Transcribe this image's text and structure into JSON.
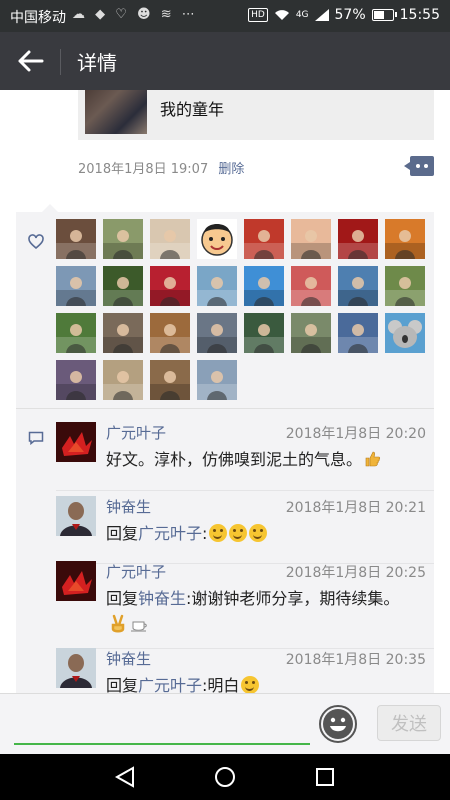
{
  "status_bar": {
    "carrier": "中国移动",
    "notification_icons": "☁ ◆ ♡ ☻ ≋ ⋯",
    "hd": "HD",
    "network": "4G",
    "battery": "57%",
    "battery_level": 0.57,
    "time": "15:55"
  },
  "title_bar": {
    "title": "详情"
  },
  "post": {
    "shared_title": "我的童年",
    "date": "2018年1月8日 19:07",
    "delete_label": "删除"
  },
  "likes": {
    "avatar_colors": [
      [
        "#6b4e3d",
        "#8a9a6a",
        "#d9c7b0",
        "#f2c98a",
        "#c0392b",
        "#e8b99a",
        "#a11818",
        "#d87a2a"
      ],
      [
        "#7d98b5",
        "#3c5a2a",
        "#b82030",
        "#7aa6c7",
        "#3f8fd6",
        "#cf5a5a",
        "#4e7fb0",
        "#6e8a4a"
      ],
      [
        "#4f7a3a",
        "#7a6a5a",
        "#9c6a3c",
        "#6a7686",
        "#3a5a3e",
        "#7a8a6a",
        "#4a6a9a",
        "#5aa0d0"
      ],
      [
        "#6a5a7a",
        "#b4a080",
        "#8a6a4a",
        "#8aa0b8"
      ]
    ],
    "avatar_icon_names": [
      "person-avatar-icon",
      "cartoon-face-avatar-icon",
      "koala-avatar-icon"
    ]
  },
  "comments": [
    {
      "name": "广元叶子",
      "time": "2018年1月8日 20:20",
      "text": "好文。淳朴，仿佛嗅到泥土的气息。",
      "emojis": [
        "thumbs-up-icon"
      ]
    },
    {
      "name": "钟奋生",
      "time": "2018年1月8日 20:21",
      "reply_prefix": "回复",
      "reply_to": "广元叶子",
      "text": ":",
      "emojis": [
        "smile-icon",
        "smile-icon",
        "smile-icon"
      ]
    },
    {
      "name": "广元叶子",
      "time": "2018年1月8日 20:25",
      "reply_prefix": "回复",
      "reply_to": "钟奋生",
      "text": ":谢谢钟老师分享，期待续集。",
      "emojis": [
        "victory-hand-icon",
        "coffee-cup-icon"
      ]
    },
    {
      "name": "钟奋生",
      "time": "2018年1月8日 20:35",
      "reply_prefix": "回复",
      "reply_to": "广元叶子",
      "text": ":明白",
      "emojis": [
        "smile-icon"
      ]
    }
  ],
  "input_bar": {
    "placeholder": "",
    "send_label": "发送"
  },
  "colors": {
    "title_bar": "#393a3f",
    "link_blue": "#576b95",
    "input_underline": "#45b649"
  }
}
